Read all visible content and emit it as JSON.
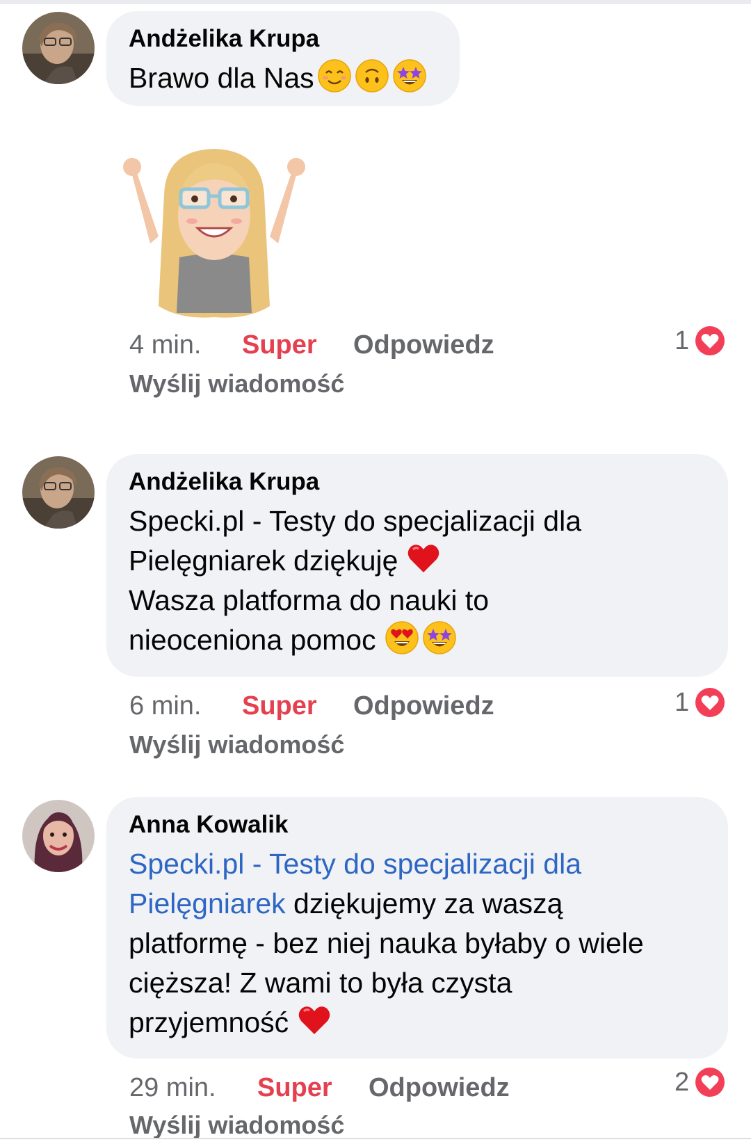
{
  "comments": [
    {
      "author": "Andżelika Krupa",
      "text": "Brawo dla Nas",
      "emojis": [
        "smiling-face-icon",
        "upside-down-face-icon",
        "star-struck-icon"
      ],
      "sticker": "avatar-sticker-arms-raised",
      "time": "4 min.",
      "reaction_label": "Super",
      "reply_label": "Odpowiedz",
      "message_label": "Wyślij wiadomość",
      "reaction_count": "1"
    },
    {
      "author": "Andżelika Krupa",
      "lines": [
        "Specki.pl - Testy do specjalizacji dla",
        "Pielęgniarek dziękuję",
        "Wasza platforma do nauki to",
        "nieoceniona pomoc"
      ],
      "time": "6 min.",
      "reaction_label": "Super",
      "reply_label": "Odpowiedz",
      "message_label": "Wyślij wiadomość",
      "reaction_count": "1"
    },
    {
      "author": "Anna Kowalik",
      "mention_lines": [
        "Specki.pl - Testy do specjalizacji dla",
        "Pielęgniarek"
      ],
      "lines": [
        " dziękujemy za waszą",
        "platformę - bez niej nauka byłaby o wiele",
        "cięższa! Z wami to była czysta",
        "przyjemność"
      ],
      "time": "29 min.",
      "reaction_label": "Super",
      "reply_label": "Odpowiedz",
      "message_label": "Wyślij wiadomość",
      "reaction_count": "2"
    }
  ],
  "colors": {
    "bubble": "#f0f2f5",
    "super": "#e4404f",
    "mention": "#2d66c3",
    "meta": "#65676b",
    "love": "#f33e58"
  }
}
